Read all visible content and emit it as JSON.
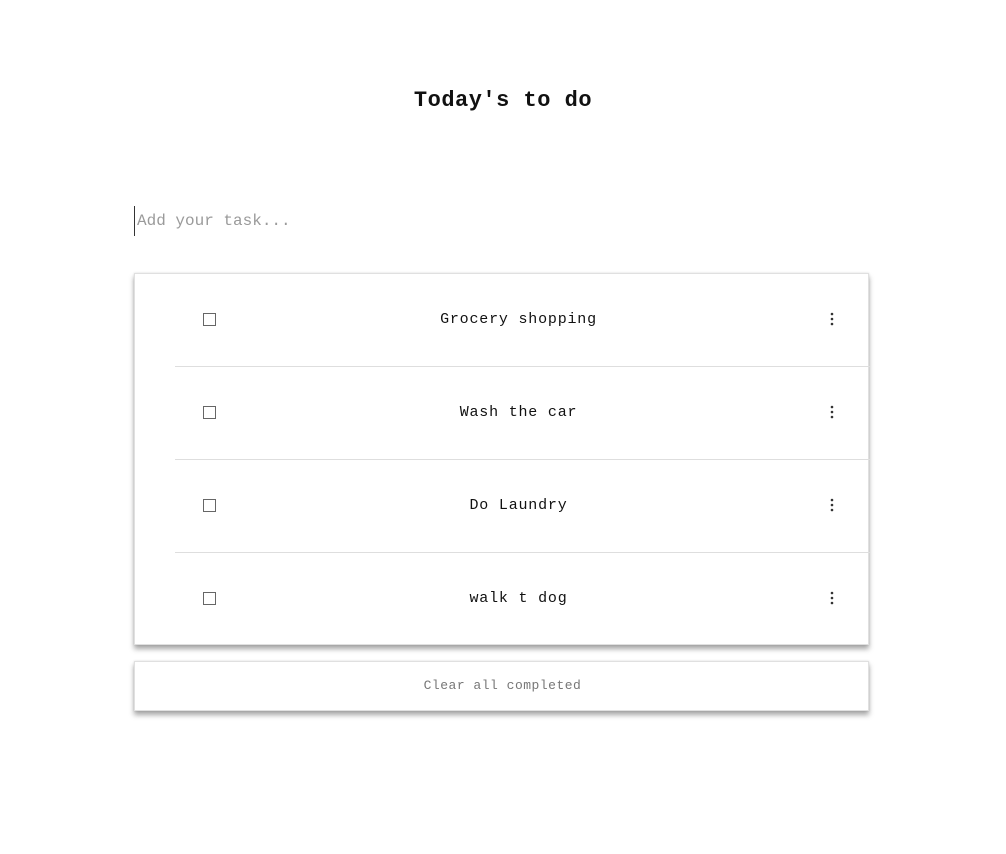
{
  "header": {
    "title": "Today's to do"
  },
  "new_task": {
    "placeholder": "Add your task...",
    "value": ""
  },
  "tasks": [
    {
      "label": "Grocery shopping",
      "completed": false,
      "menu_icon": "kebab-menu-icon"
    },
    {
      "label": "Wash the car",
      "completed": false,
      "menu_icon": "kebab-menu-icon"
    },
    {
      "label": "Do Laundry",
      "completed": false,
      "menu_icon": "kebab-menu-icon"
    },
    {
      "label": "walk t dog",
      "completed": false,
      "menu_icon": "kebab-menu-icon"
    }
  ],
  "footer": {
    "clear_label": "Clear all completed"
  }
}
